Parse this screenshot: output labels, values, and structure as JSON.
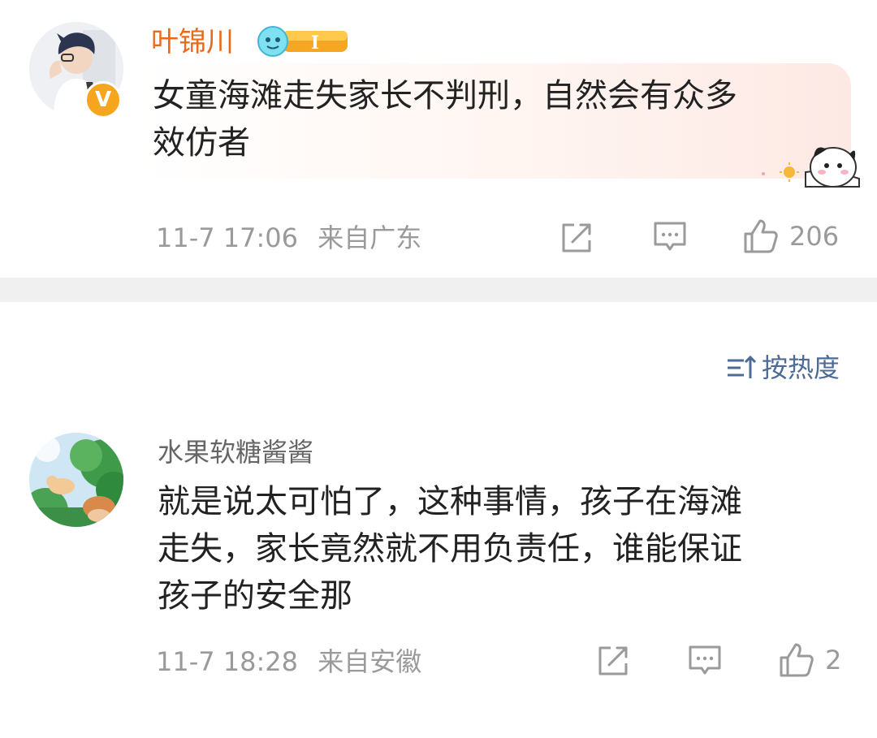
{
  "post": {
    "author": "叶锦川",
    "level_badge_text": "I",
    "content_lines": [
      "女童海滩走失家长不判刑，自然会有众多",
      "效仿者"
    ],
    "timestamp": "11-7 17:06",
    "location": "来自广东",
    "like_count": "206"
  },
  "sort": {
    "label": "按热度"
  },
  "comments": [
    {
      "author": "水果软糖酱酱",
      "content_lines": [
        "就是说太可怕了，这种事情，孩子在海滩",
        "走失，家长竟然就不用负责任，谁能保证",
        "孩子的安全那"
      ],
      "timestamp": "11-7 18:28",
      "location": "来自安徽",
      "like_count": "2"
    }
  ],
  "icons": {
    "share": "share-icon",
    "comment": "comment-icon",
    "like": "thumbs-up-icon",
    "sort": "sort-icon",
    "verified": "verified-badge-icon"
  },
  "colors": {
    "author_highlight": "#e86a1c",
    "sort_link": "#4c6b96",
    "meta_gray": "#9a9a9a",
    "verified_badge": "#f6a51e",
    "divider": "#f0f0f0"
  }
}
